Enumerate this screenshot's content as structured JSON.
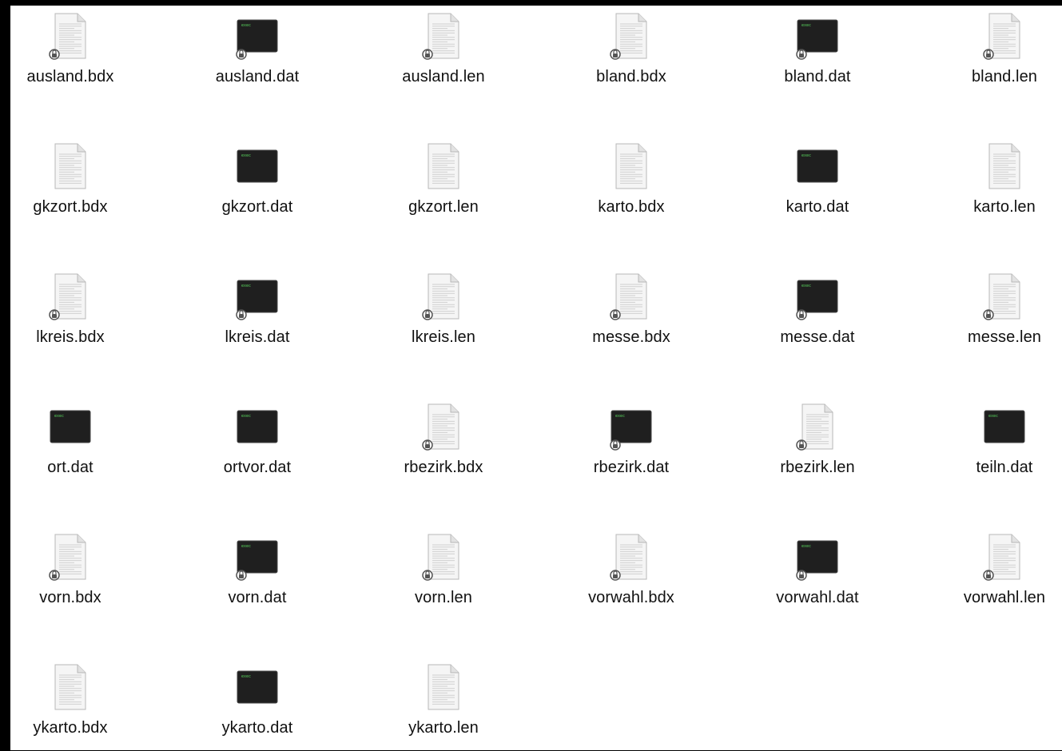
{
  "window": {
    "title": ""
  },
  "colors": {
    "background": "#ffffff",
    "exec_icon_bg": "#1f1f1f",
    "exec_text": "#58d35c",
    "doc_fill": "#f5f5f5",
    "doc_border": "#b8b8b8",
    "lock_color": "#555555"
  },
  "exec_badge_text": "exec",
  "files": [
    {
      "name": "ausland.bdx",
      "icon": "document-icon",
      "locked": true
    },
    {
      "name": "ausland.dat",
      "icon": "exec-icon",
      "locked": true
    },
    {
      "name": "ausland.len",
      "icon": "document-icon",
      "locked": true
    },
    {
      "name": "bland.bdx",
      "icon": "document-icon",
      "locked": true
    },
    {
      "name": "bland.dat",
      "icon": "exec-icon",
      "locked": true
    },
    {
      "name": "bland.len",
      "icon": "document-icon",
      "locked": true
    },
    {
      "name": "gkzort.bdx",
      "icon": "document-icon",
      "locked": false
    },
    {
      "name": "gkzort.dat",
      "icon": "exec-icon",
      "locked": false
    },
    {
      "name": "gkzort.len",
      "icon": "document-icon",
      "locked": false
    },
    {
      "name": "karto.bdx",
      "icon": "document-icon",
      "locked": false
    },
    {
      "name": "karto.dat",
      "icon": "exec-icon",
      "locked": false
    },
    {
      "name": "karto.len",
      "icon": "document-icon",
      "locked": false
    },
    {
      "name": "lkreis.bdx",
      "icon": "document-icon",
      "locked": true
    },
    {
      "name": "lkreis.dat",
      "icon": "exec-icon",
      "locked": true
    },
    {
      "name": "lkreis.len",
      "icon": "document-icon",
      "locked": true
    },
    {
      "name": "messe.bdx",
      "icon": "document-icon",
      "locked": true
    },
    {
      "name": "messe.dat",
      "icon": "exec-icon",
      "locked": true
    },
    {
      "name": "messe.len",
      "icon": "document-icon",
      "locked": true
    },
    {
      "name": "ort.dat",
      "icon": "exec-icon",
      "locked": false
    },
    {
      "name": "ortvor.dat",
      "icon": "exec-icon",
      "locked": false
    },
    {
      "name": "rbezirk.bdx",
      "icon": "document-icon",
      "locked": true
    },
    {
      "name": "rbezirk.dat",
      "icon": "exec-icon",
      "locked": true
    },
    {
      "name": "rbezirk.len",
      "icon": "document-icon",
      "locked": true
    },
    {
      "name": "teiln.dat",
      "icon": "exec-icon",
      "locked": false
    },
    {
      "name": "vorn.bdx",
      "icon": "document-icon",
      "locked": true
    },
    {
      "name": "vorn.dat",
      "icon": "exec-icon",
      "locked": true
    },
    {
      "name": "vorn.len",
      "icon": "document-icon",
      "locked": true
    },
    {
      "name": "vorwahl.bdx",
      "icon": "document-icon",
      "locked": true
    },
    {
      "name": "vorwahl.dat",
      "icon": "exec-icon",
      "locked": true
    },
    {
      "name": "vorwahl.len",
      "icon": "document-icon",
      "locked": true
    },
    {
      "name": "ykarto.bdx",
      "icon": "document-icon",
      "locked": false
    },
    {
      "name": "ykarto.dat",
      "icon": "exec-icon",
      "locked": false
    },
    {
      "name": "ykarto.len",
      "icon": "document-icon",
      "locked": false
    }
  ]
}
